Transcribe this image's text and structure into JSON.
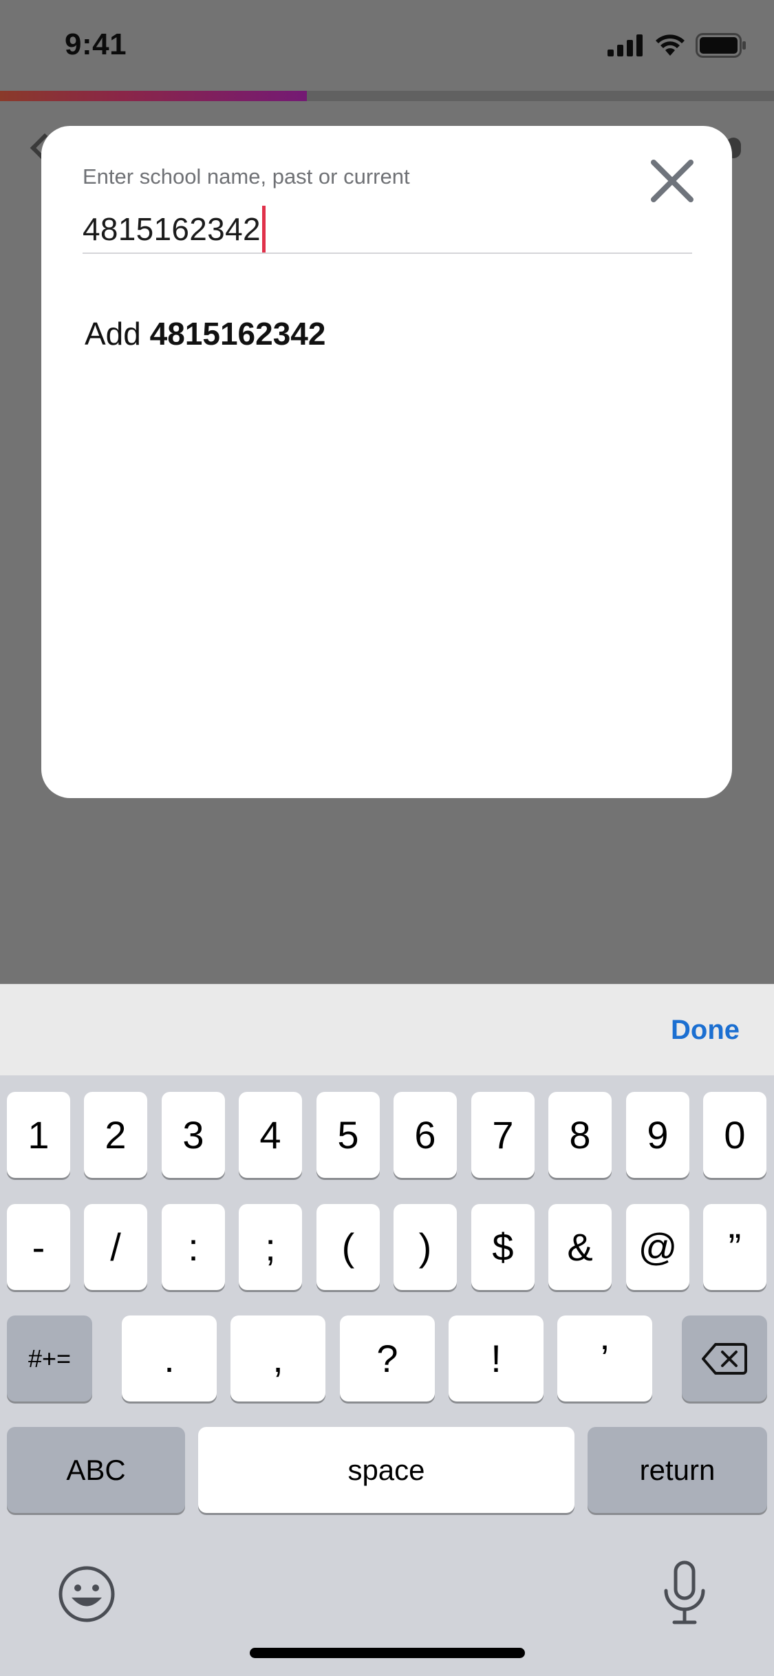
{
  "status_bar": {
    "time": "9:41",
    "icons": [
      "signal-icon",
      "wifi-icon",
      "battery-icon"
    ]
  },
  "progress": {
    "fraction": 0.396,
    "colors": [
      "#8a3a2a",
      "#741a74"
    ]
  },
  "modal": {
    "label": "Enter school name, past or current",
    "input_value": "4815162342",
    "close_icon": "close-icon",
    "add_option": {
      "prefix": "Add ",
      "value": "4815162342"
    }
  },
  "keyboard": {
    "done_label": "Done",
    "row1": [
      "1",
      "2",
      "3",
      "4",
      "5",
      "6",
      "7",
      "8",
      "9",
      "0"
    ],
    "row2": [
      "-",
      "/",
      ":",
      ";",
      "(",
      ")",
      "$",
      "&",
      "@",
      "”"
    ],
    "row3": {
      "shift_label": "#+=",
      "keys": [
        ".",
        ",",
        "?",
        "!",
        "’"
      ],
      "delete_icon": "backspace-icon"
    },
    "row4": {
      "abc_label": "ABC",
      "space_label": "space",
      "return_label": "return"
    },
    "emoji_icon": "emoji-icon",
    "mic_icon": "microphone-icon"
  },
  "accent_colors": {
    "done": "#1b6fd1",
    "caret": "#e0314a"
  }
}
